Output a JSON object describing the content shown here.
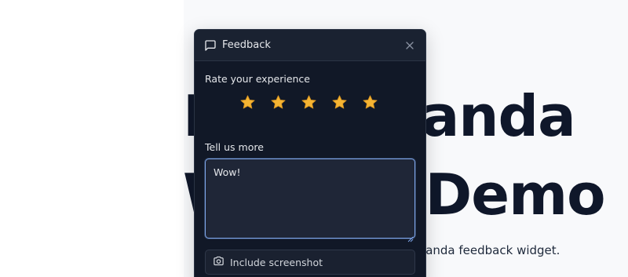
{
  "page": {
    "hero_line1": "HappyPanda",
    "hero_line2": "Widget Demo",
    "hero_sub": "This is a demo page for the HappyPanda feedback widget."
  },
  "widget": {
    "title": "Feedback",
    "header_icon": "message-square-icon",
    "close_icon": "close-icon",
    "rating": {
      "label": "Rate your experience",
      "value": 5,
      "max": 5,
      "star_color": "#f5b433"
    },
    "comment": {
      "label": "Tell us more",
      "value": "Wow!"
    },
    "screenshot_button": {
      "label": "Include screenshot",
      "icon": "camera-icon"
    }
  },
  "colors": {
    "widget_bg": "#111827",
    "header_bg": "#1a2231",
    "focus_border": "#7fa7ec",
    "page_bg": "#f8f9fb",
    "hero_text": "#0f172a"
  }
}
